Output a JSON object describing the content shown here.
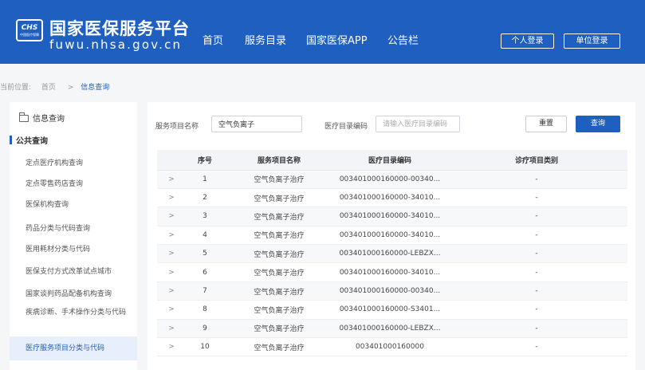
{
  "header": {
    "logo_mark": "CHS",
    "logo_sub": "中国医疗保障",
    "title": "国家医保服务平台",
    "url": "fuwu.nhsa.gov.cn",
    "nav": [
      "首页",
      "服务目录",
      "国家医保APP",
      "公告栏"
    ],
    "personal_login": "个人登录",
    "unit_login": "单位登录"
  },
  "breadcrumb": {
    "label": "当前位置:",
    "home": "首页",
    "separator": ">",
    "current": "信息查询"
  },
  "sidebar": {
    "heading": "信息查询",
    "group": "公共查询",
    "items": [
      "定点医疗机构查询",
      "定点零售药店查询",
      "医保机构查询",
      "药品分类与代码查询",
      "医用耗材分类与代码",
      "医保支付方式改革试点城市",
      "国家谈判药品配备机构查询",
      "疾病诊断、手术操作分类与代码",
      "医疗服务项目分类与代码"
    ],
    "active_index": 8
  },
  "search": {
    "name_label": "服务项目名称",
    "name_value": "空气负离子",
    "code_label": "医疗目录编码",
    "code_placeholder": "请输入医疗目录编码",
    "reset_label": "重置",
    "query_label": "查询"
  },
  "table": {
    "columns": [
      "序号",
      "服务项目名称",
      "医疗目录编码",
      "诊疗项目类别"
    ],
    "expand_glyph": ">",
    "rows": [
      {
        "no": "1",
        "name": "空气负离子治疗",
        "code": "003401000160000-00340...",
        "category": "-"
      },
      {
        "no": "2",
        "name": "空气负离子治疗",
        "code": "003401000160000-34010...",
        "category": "-"
      },
      {
        "no": "3",
        "name": "空气负离子治疗",
        "code": "003401000160000-34010...",
        "category": "-"
      },
      {
        "no": "4",
        "name": "空气负离子治疗",
        "code": "003401000160000-34010...",
        "category": "-"
      },
      {
        "no": "5",
        "name": "空气负离子治疗",
        "code": "003401000160000-LEBZX...",
        "category": "-"
      },
      {
        "no": "6",
        "name": "空气负离子治疗",
        "code": "003401000160000-34010...",
        "category": "-"
      },
      {
        "no": "7",
        "name": "空气负离子治疗",
        "code": "003401000160000-00340...",
        "category": "-"
      },
      {
        "no": "8",
        "name": "空气负离子治疗",
        "code": "003401000160000-S3401...",
        "category": "-"
      },
      {
        "no": "9",
        "name": "空气负离子治疗",
        "code": "003401000160000-LEBZX...",
        "category": "-"
      },
      {
        "no": "10",
        "name": "空气负离子治疗",
        "code": "003401000160000",
        "category": "-"
      }
    ]
  },
  "colors": {
    "brand": "#1f5fbf",
    "active_bg": "#e6effb"
  }
}
